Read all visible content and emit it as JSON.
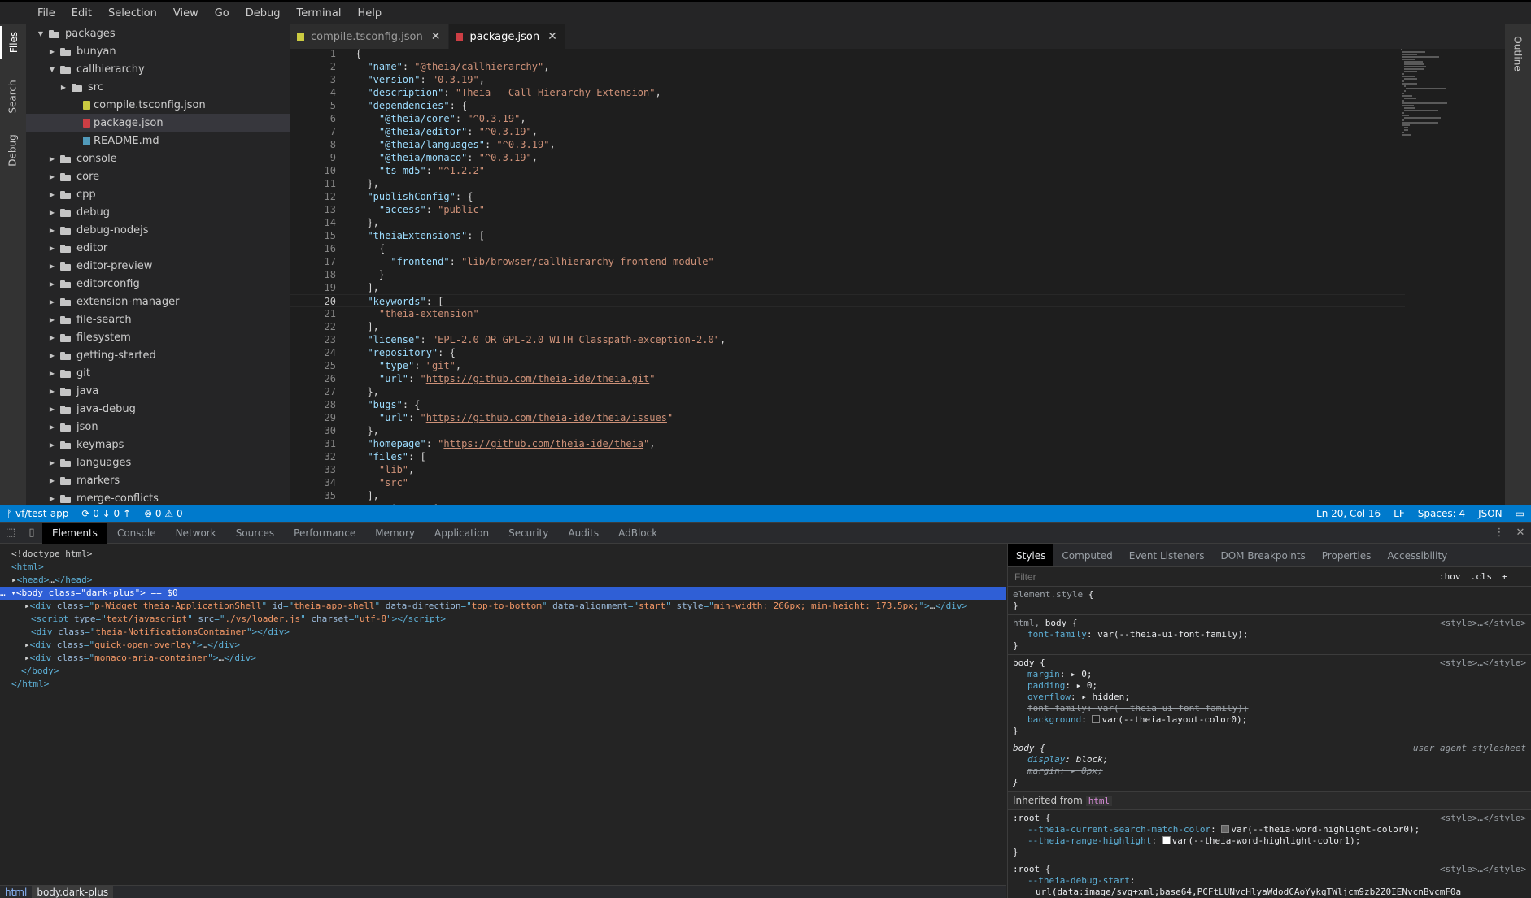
{
  "menu": [
    "File",
    "Edit",
    "Selection",
    "View",
    "Go",
    "Debug",
    "Terminal",
    "Help"
  ],
  "leftbar": {
    "files": "Files",
    "search": "Search",
    "debug": "Debug"
  },
  "rightbar": {
    "outline": "Outline"
  },
  "explorer": {
    "rows": [
      {
        "label": "packages",
        "indent": 0,
        "kind": "folder",
        "open": true
      },
      {
        "label": "bunyan",
        "indent": 1,
        "kind": "folder",
        "open": false
      },
      {
        "label": "callhierarchy",
        "indent": 1,
        "kind": "folder",
        "open": true
      },
      {
        "label": "src",
        "indent": 2,
        "kind": "folder",
        "open": false
      },
      {
        "label": "compile.tsconfig.json",
        "indent": 2,
        "kind": "json"
      },
      {
        "label": "package.json",
        "indent": 2,
        "kind": "pkg",
        "selected": true
      },
      {
        "label": "README.md",
        "indent": 2,
        "kind": "md"
      },
      {
        "label": "console",
        "indent": 1,
        "kind": "folder",
        "open": false
      },
      {
        "label": "core",
        "indent": 1,
        "kind": "folder",
        "open": false
      },
      {
        "label": "cpp",
        "indent": 1,
        "kind": "folder",
        "open": false
      },
      {
        "label": "debug",
        "indent": 1,
        "kind": "folder",
        "open": false
      },
      {
        "label": "debug-nodejs",
        "indent": 1,
        "kind": "folder",
        "open": false
      },
      {
        "label": "editor",
        "indent": 1,
        "kind": "folder",
        "open": false
      },
      {
        "label": "editor-preview",
        "indent": 1,
        "kind": "folder",
        "open": false
      },
      {
        "label": "editorconfig",
        "indent": 1,
        "kind": "folder",
        "open": false
      },
      {
        "label": "extension-manager",
        "indent": 1,
        "kind": "folder",
        "open": false
      },
      {
        "label": "file-search",
        "indent": 1,
        "kind": "folder",
        "open": false
      },
      {
        "label": "filesystem",
        "indent": 1,
        "kind": "folder",
        "open": false
      },
      {
        "label": "getting-started",
        "indent": 1,
        "kind": "folder",
        "open": false
      },
      {
        "label": "git",
        "indent": 1,
        "kind": "folder",
        "open": false
      },
      {
        "label": "java",
        "indent": 1,
        "kind": "folder",
        "open": false
      },
      {
        "label": "java-debug",
        "indent": 1,
        "kind": "folder",
        "open": false
      },
      {
        "label": "json",
        "indent": 1,
        "kind": "folder",
        "open": false
      },
      {
        "label": "keymaps",
        "indent": 1,
        "kind": "folder",
        "open": false
      },
      {
        "label": "languages",
        "indent": 1,
        "kind": "folder",
        "open": false
      },
      {
        "label": "markers",
        "indent": 1,
        "kind": "folder",
        "open": false
      },
      {
        "label": "merge-conflicts",
        "indent": 1,
        "kind": "folder",
        "open": false
      }
    ]
  },
  "tabs": [
    {
      "label": "compile.tsconfig.json",
      "kind": "json",
      "active": false
    },
    {
      "label": "package.json",
      "kind": "pkg",
      "active": true
    }
  ],
  "editor": {
    "current_line": 20,
    "lines": [
      [
        [
          "p",
          "{"
        ]
      ],
      [
        [
          "p",
          "  "
        ],
        [
          "k",
          "\"name\""
        ],
        [
          "p",
          ": "
        ],
        [
          "s",
          "\"@theia/callhierarchy\""
        ],
        [
          "p",
          ","
        ]
      ],
      [
        [
          "p",
          "  "
        ],
        [
          "k",
          "\"version\""
        ],
        [
          "p",
          ": "
        ],
        [
          "s",
          "\"0.3.19\""
        ],
        [
          "p",
          ","
        ]
      ],
      [
        [
          "p",
          "  "
        ],
        [
          "k",
          "\"description\""
        ],
        [
          "p",
          ": "
        ],
        [
          "s",
          "\"Theia - Call Hierarchy Extension\""
        ],
        [
          "p",
          ","
        ]
      ],
      [
        [
          "p",
          "  "
        ],
        [
          "k",
          "\"dependencies\""
        ],
        [
          "p",
          ": {"
        ]
      ],
      [
        [
          "p",
          "    "
        ],
        [
          "k",
          "\"@theia/core\""
        ],
        [
          "p",
          ": "
        ],
        [
          "s",
          "\"^0.3.19\""
        ],
        [
          "p",
          ","
        ]
      ],
      [
        [
          "p",
          "    "
        ],
        [
          "k",
          "\"@theia/editor\""
        ],
        [
          "p",
          ": "
        ],
        [
          "s",
          "\"^0.3.19\""
        ],
        [
          "p",
          ","
        ]
      ],
      [
        [
          "p",
          "    "
        ],
        [
          "k",
          "\"@theia/languages\""
        ],
        [
          "p",
          ": "
        ],
        [
          "s",
          "\"^0.3.19\""
        ],
        [
          "p",
          ","
        ]
      ],
      [
        [
          "p",
          "    "
        ],
        [
          "k",
          "\"@theia/monaco\""
        ],
        [
          "p",
          ": "
        ],
        [
          "s",
          "\"^0.3.19\""
        ],
        [
          "p",
          ","
        ]
      ],
      [
        [
          "p",
          "    "
        ],
        [
          "k",
          "\"ts-md5\""
        ],
        [
          "p",
          ": "
        ],
        [
          "s",
          "\"^1.2.2\""
        ]
      ],
      [
        [
          "p",
          "  },"
        ]
      ],
      [
        [
          "p",
          "  "
        ],
        [
          "k",
          "\"publishConfig\""
        ],
        [
          "p",
          ": {"
        ]
      ],
      [
        [
          "p",
          "    "
        ],
        [
          "k",
          "\"access\""
        ],
        [
          "p",
          ": "
        ],
        [
          "s",
          "\"public\""
        ]
      ],
      [
        [
          "p",
          "  },"
        ]
      ],
      [
        [
          "p",
          "  "
        ],
        [
          "k",
          "\"theiaExtensions\""
        ],
        [
          "p",
          ": ["
        ]
      ],
      [
        [
          "p",
          "    {"
        ]
      ],
      [
        [
          "p",
          "      "
        ],
        [
          "k",
          "\"frontend\""
        ],
        [
          "p",
          ": "
        ],
        [
          "s",
          "\"lib/browser/callhierarchy-frontend-module\""
        ]
      ],
      [
        [
          "p",
          "    }"
        ]
      ],
      [
        [
          "p",
          "  ],"
        ]
      ],
      [
        [
          "p",
          "  "
        ],
        [
          "k",
          "\"keywords\""
        ],
        [
          "p",
          ": ["
        ]
      ],
      [
        [
          "p",
          "    "
        ],
        [
          "s",
          "\"theia-extension\""
        ]
      ],
      [
        [
          "p",
          "  ],"
        ]
      ],
      [
        [
          "p",
          "  "
        ],
        [
          "k",
          "\"license\""
        ],
        [
          "p",
          ": "
        ],
        [
          "s",
          "\"EPL-2.0 OR GPL-2.0 WITH Classpath-exception-2.0\""
        ],
        [
          "p",
          ","
        ]
      ],
      [
        [
          "p",
          "  "
        ],
        [
          "k",
          "\"repository\""
        ],
        [
          "p",
          ": {"
        ]
      ],
      [
        [
          "p",
          "    "
        ],
        [
          "k",
          "\"type\""
        ],
        [
          "p",
          ": "
        ],
        [
          "s",
          "\"git\""
        ],
        [
          "p",
          ","
        ]
      ],
      [
        [
          "p",
          "    "
        ],
        [
          "k",
          "\"url\""
        ],
        [
          "p",
          ": "
        ],
        [
          "s",
          "\""
        ],
        [
          "url",
          "https://github.com/theia-ide/theia.git"
        ],
        [
          "s",
          "\""
        ]
      ],
      [
        [
          "p",
          "  },"
        ]
      ],
      [
        [
          "p",
          "  "
        ],
        [
          "k",
          "\"bugs\""
        ],
        [
          "p",
          ": {"
        ]
      ],
      [
        [
          "p",
          "    "
        ],
        [
          "k",
          "\"url\""
        ],
        [
          "p",
          ": "
        ],
        [
          "s",
          "\""
        ],
        [
          "url",
          "https://github.com/theia-ide/theia/issues"
        ],
        [
          "s",
          "\""
        ]
      ],
      [
        [
          "p",
          "  },"
        ]
      ],
      [
        [
          "p",
          "  "
        ],
        [
          "k",
          "\"homepage\""
        ],
        [
          "p",
          ": "
        ],
        [
          "s",
          "\""
        ],
        [
          "url",
          "https://github.com/theia-ide/theia"
        ],
        [
          "s",
          "\""
        ],
        [
          "p",
          ","
        ]
      ],
      [
        [
          "p",
          "  "
        ],
        [
          "k",
          "\"files\""
        ],
        [
          "p",
          ": ["
        ]
      ],
      [
        [
          "p",
          "    "
        ],
        [
          "s",
          "\"lib\""
        ],
        [
          "p",
          ","
        ]
      ],
      [
        [
          "p",
          "    "
        ],
        [
          "s",
          "\"src\""
        ]
      ],
      [
        [
          "p",
          "  ],"
        ]
      ],
      [
        [
          "p",
          "  "
        ],
        [
          "k",
          "\"scripts\""
        ],
        [
          "p",
          ": {"
        ]
      ]
    ]
  },
  "statusbar": {
    "branch": "ᚠ vf/test-app",
    "sync": "⟳ 0 ↓ 0 ↑",
    "problems": "⊗ 0 ⚠ 0",
    "position": "Ln 20, Col 16",
    "eol": "LF",
    "spaces": "Spaces: 4",
    "language": "JSON"
  },
  "devtools": {
    "tabs": [
      "Elements",
      "Console",
      "Network",
      "Sources",
      "Performance",
      "Memory",
      "Application",
      "Security",
      "Audits",
      "AdBlock"
    ],
    "active_tab": "Elements",
    "breadcrumb": [
      "html",
      "body.dark-plus"
    ],
    "styles_tabs": [
      "Styles",
      "Computed",
      "Event Listeners",
      "DOM Breakpoints",
      "Properties",
      "Accessibility"
    ],
    "filter_placeholder": "Filter",
    "hov": ":hov",
    "cls": ".cls",
    "plus": "+",
    "inherited_label": "Inherited from",
    "inherited_tag": "html",
    "source_style": "<style>…</style>",
    "user_agent": "user agent stylesheet"
  }
}
